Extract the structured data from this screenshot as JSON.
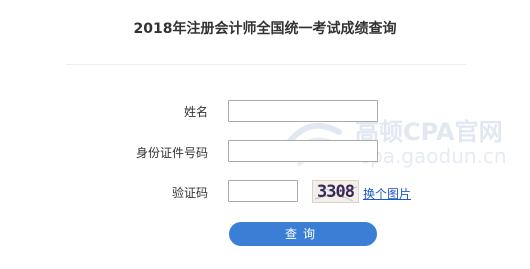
{
  "page": {
    "title": "2018年注册会计师全国统一考试成绩查询"
  },
  "form": {
    "name_label": "姓名",
    "name_value": "",
    "id_label": "身份证件号码",
    "id_value": "",
    "captcha_label": "验证码",
    "captcha_value": "",
    "captcha_image_text": "3308",
    "refresh_captcha_label": "换个图片",
    "submit_label": "查询"
  },
  "watermark": {
    "brand": "高顿CPA官网",
    "url": "cpa.gaodun.cn"
  },
  "colors": {
    "accent": "#3a7fd5",
    "link": "#1e58c8",
    "watermark": "#e2e8f2"
  }
}
